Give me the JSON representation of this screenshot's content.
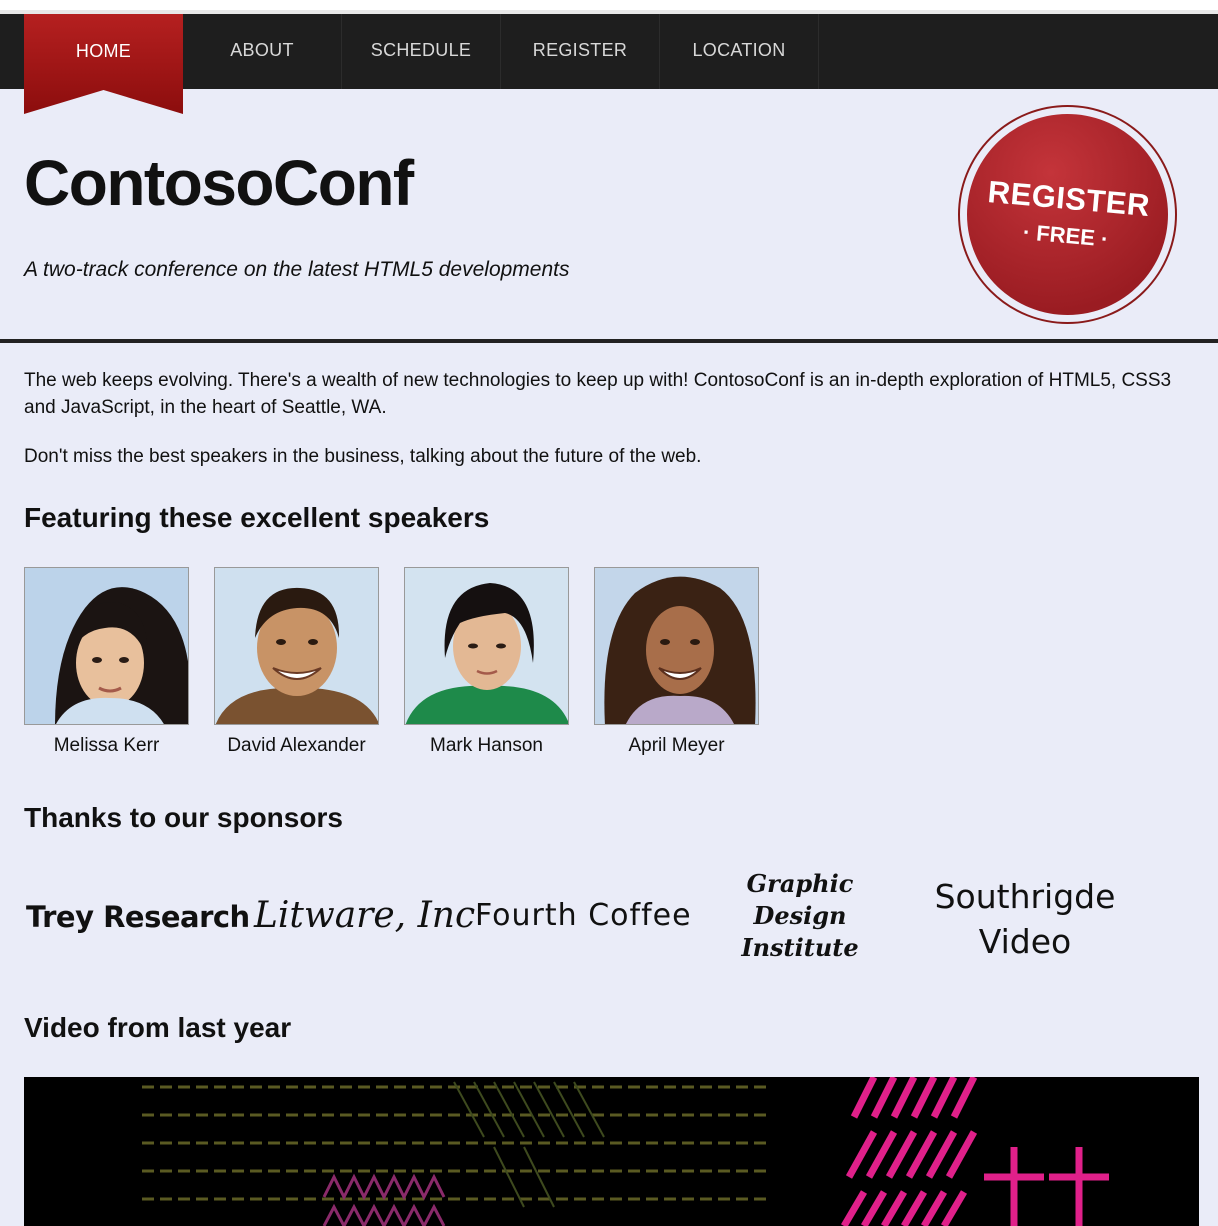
{
  "nav": {
    "items": [
      {
        "label": "HOME"
      },
      {
        "label": "ABOUT"
      },
      {
        "label": "SCHEDULE"
      },
      {
        "label": "REGISTER"
      },
      {
        "label": "LOCATION"
      }
    ]
  },
  "header": {
    "title": "ContosoConf",
    "tagline": "A two-track conference on the latest HTML5 developments",
    "register_badge": {
      "main": "REGISTER",
      "sub": "· FREE ·"
    }
  },
  "intro": {
    "p1": "The web keeps evolving. There's a wealth of new technologies to keep up with! ContosoConf is an in-depth exploration of HTML5, CSS3 and JavaScript, in the heart of Seattle, WA.",
    "p2": "Don't miss the best speakers in the business, talking about the future of the web."
  },
  "speakers": {
    "heading": "Featuring these excellent speakers",
    "items": [
      {
        "name": "Melissa Kerr"
      },
      {
        "name": "David Alexander"
      },
      {
        "name": "Mark Hanson"
      },
      {
        "name": "April Meyer"
      }
    ]
  },
  "sponsors": {
    "heading": "Thanks to our sponsors",
    "items": [
      {
        "name": "Trey Research"
      },
      {
        "name": "Litware, Inc"
      },
      {
        "name": "Fourth Coffee"
      },
      {
        "name": "Graphic Design Institute"
      },
      {
        "name": "Southrigde Video"
      }
    ]
  },
  "video": {
    "heading": "Video from last year"
  },
  "colors": {
    "accent": "#a31515",
    "nav_bg": "#1e1e1e",
    "page_bg": "#eaecf8"
  }
}
